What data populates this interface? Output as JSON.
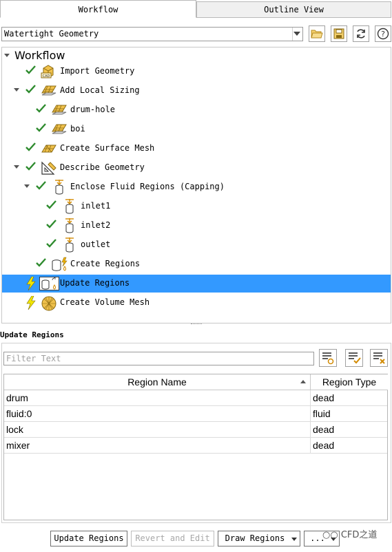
{
  "tabs": [
    {
      "label": "Workflow",
      "active": true
    },
    {
      "label": "Outline View",
      "active": false
    }
  ],
  "workflow_selector": {
    "value": "Watertight Geometry"
  },
  "toolbar_icons": [
    "open-folder-icon",
    "save-icon",
    "refresh-icon",
    "help-icon"
  ],
  "tree": {
    "root_label": "Workflow",
    "items": [
      {
        "label": "Import Geometry",
        "status": "done"
      },
      {
        "label": "Add Local Sizing",
        "status": "done",
        "expanded": true
      },
      {
        "label": "drum-hole",
        "status": "done"
      },
      {
        "label": "boi",
        "status": "done"
      },
      {
        "label": "Create Surface Mesh",
        "status": "done"
      },
      {
        "label": "Describe Geometry",
        "status": "done",
        "expanded": true
      },
      {
        "label": "Enclose Fluid Regions (Capping)",
        "status": "done",
        "expanded": true
      },
      {
        "label": "inlet1",
        "status": "done"
      },
      {
        "label": "inlet2",
        "status": "done"
      },
      {
        "label": "outlet",
        "status": "done"
      },
      {
        "label": "Create Regions",
        "status": "done"
      },
      {
        "label": "Update Regions",
        "status": "pending",
        "selected": true
      },
      {
        "label": "Create Volume Mesh",
        "status": "pending"
      }
    ]
  },
  "update_regions": {
    "title": "Update Regions",
    "filter_placeholder": "Filter Text",
    "columns": [
      "Region Name",
      "Region Type"
    ],
    "rows": [
      {
        "name": "drum",
        "type": "dead"
      },
      {
        "name": "fluid:0",
        "type": "fluid"
      },
      {
        "name": "lock",
        "type": "dead"
      },
      {
        "name": "mixer",
        "type": "dead"
      }
    ]
  },
  "buttons": {
    "update": "Update Regions",
    "revert": "Revert and Edit",
    "draw": "Draw Regions",
    "more": "..."
  },
  "watermark": "CFD之道",
  "colors": {
    "selection": "#3399ff",
    "check": "#2e8b2e",
    "lightning": "#f2d600",
    "icon_gold": "#e0b24a"
  }
}
